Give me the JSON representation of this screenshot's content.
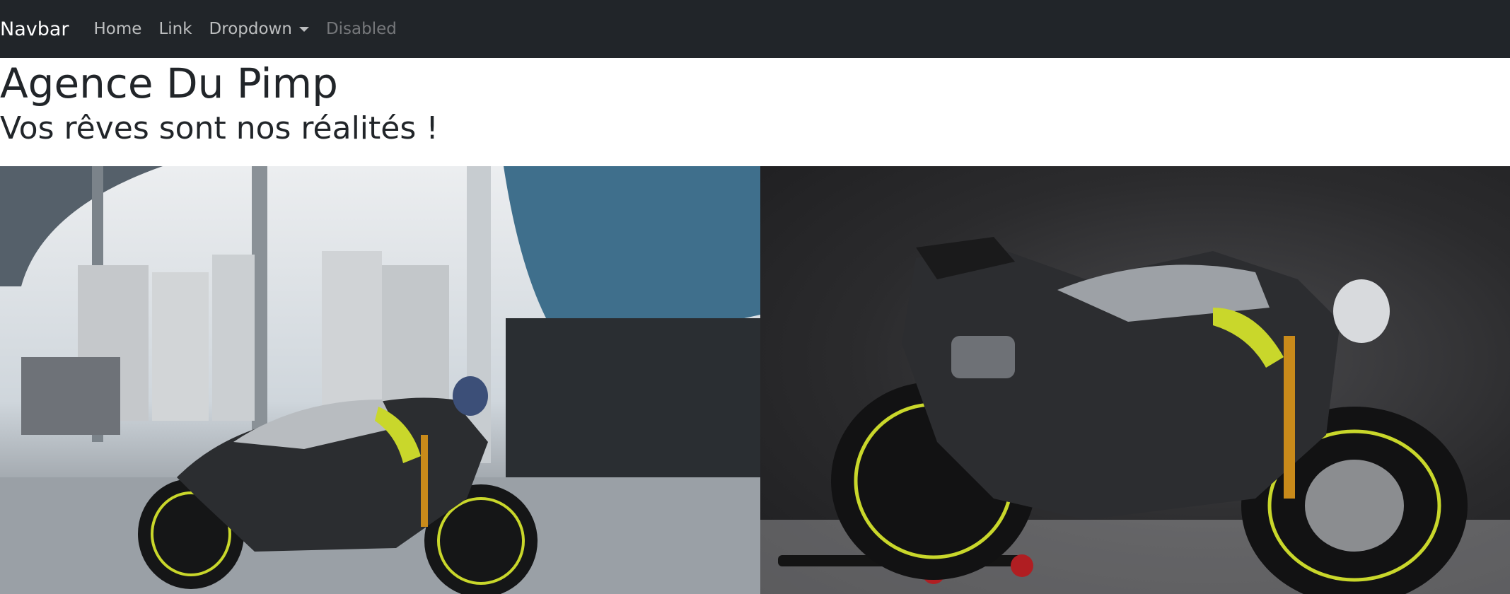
{
  "navbar": {
    "brand": "Navbar",
    "links": [
      "Home",
      "Link",
      "Dropdown",
      "Disabled"
    ]
  },
  "header": {
    "title": "Agence Du Pimp",
    "subtitle": "Vos rêves sont nos réalités !"
  },
  "gallery": {
    "images": [
      {
        "icon": "motorcycle-street-photo"
      },
      {
        "icon": "motorcycle-studio-photo"
      }
    ]
  },
  "colors": {
    "navbar_bg": "#212529",
    "accent_lime": "#c9d72b",
    "fork_gold": "#c98a1a"
  }
}
